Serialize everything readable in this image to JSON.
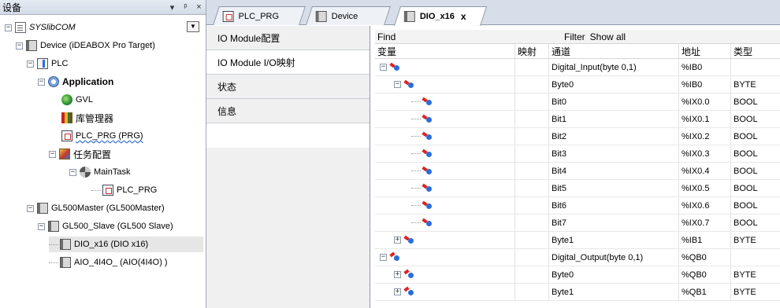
{
  "left_panel": {
    "title": "设备",
    "controls": [
      "▾",
      "ᵖ",
      "×"
    ],
    "tree": [
      {
        "label": "SYSlibCOM",
        "icon": "project-icon",
        "italic": true
      },
      {
        "label": "Device (iDEABOX Pro Target)",
        "icon": "device-icon"
      },
      {
        "label": "PLC",
        "icon": "plc-icon"
      },
      {
        "label": "Application",
        "icon": "application-gear-icon",
        "bold": true
      },
      {
        "label": "GVL",
        "icon": "gvl-icon"
      },
      {
        "label": "库管理器",
        "icon": "library-icon"
      },
      {
        "label": "PLC_PRG (PRG)",
        "icon": "program-icon",
        "wavy": true
      },
      {
        "label": "任务配置",
        "icon": "task-config-icon"
      },
      {
        "label": "MainTask",
        "icon": "maintask-icon"
      },
      {
        "label": "PLC_PRG",
        "icon": "program-call-icon"
      },
      {
        "label": "GL500Master (GL500Master)",
        "icon": "device-icon"
      },
      {
        "label": "GL500_Slave (GL500 Slave)",
        "icon": "device-icon"
      },
      {
        "label": "DIO_x16 (DIO x16)",
        "icon": "device-icon",
        "selected": true
      },
      {
        "label": "AIO_4I4O_ (AIO(4I4O) )",
        "icon": "device-icon"
      }
    ]
  },
  "editor_tabs": [
    {
      "label": "PLC_PRG",
      "icon": "program-icon",
      "active": false
    },
    {
      "label": "Device",
      "icon": "device-icon",
      "active": false
    },
    {
      "label": "DIO_x16",
      "icon": "device-icon",
      "active": true,
      "close": "x"
    }
  ],
  "page_tabs": [
    {
      "label": "IO Module配置",
      "active": false
    },
    {
      "label": "IO Module I/O映射",
      "active": true
    },
    {
      "label": "状态",
      "active": false
    },
    {
      "label": "信息",
      "active": false
    }
  ],
  "grid": {
    "find_label": "Find",
    "filter_label": "Filter",
    "filter_value": "Show all",
    "columns": [
      "变量",
      "映射",
      "通道",
      "地址",
      "类型"
    ],
    "rows": [
      {
        "level": 0,
        "expander": "−",
        "dir": "in",
        "channel": "Digital_Input(byte 0,1)",
        "address": "%IB0",
        "type": ""
      },
      {
        "level": 1,
        "expander": "−",
        "dir": "in",
        "channel": "Byte0",
        "address": "%IB0",
        "type": "BYTE"
      },
      {
        "level": 2,
        "expander": "",
        "dir": "in",
        "channel": "Bit0",
        "address": "%IX0.0",
        "type": "BOOL"
      },
      {
        "level": 2,
        "expander": "",
        "dir": "in",
        "channel": "Bit1",
        "address": "%IX0.1",
        "type": "BOOL"
      },
      {
        "level": 2,
        "expander": "",
        "dir": "in",
        "channel": "Bit2",
        "address": "%IX0.2",
        "type": "BOOL"
      },
      {
        "level": 2,
        "expander": "",
        "dir": "in",
        "channel": "Bit3",
        "address": "%IX0.3",
        "type": "BOOL"
      },
      {
        "level": 2,
        "expander": "",
        "dir": "in",
        "channel": "Bit4",
        "address": "%IX0.4",
        "type": "BOOL"
      },
      {
        "level": 2,
        "expander": "",
        "dir": "in",
        "channel": "Bit5",
        "address": "%IX0.5",
        "type": "BOOL"
      },
      {
        "level": 2,
        "expander": "",
        "dir": "in",
        "channel": "Bit6",
        "address": "%IX0.6",
        "type": "BOOL"
      },
      {
        "level": 2,
        "expander": "",
        "dir": "in",
        "channel": "Bit7",
        "address": "%IX0.7",
        "type": "BOOL"
      },
      {
        "level": 1,
        "expander": "+",
        "dir": "in",
        "channel": "Byte1",
        "address": "%IB1",
        "type": "BYTE"
      },
      {
        "level": 0,
        "expander": "−",
        "dir": "out",
        "channel": "Digital_Output(byte 0,1)",
        "address": "%QB0",
        "type": ""
      },
      {
        "level": 1,
        "expander": "+",
        "dir": "out",
        "channel": "Byte0",
        "address": "%QB0",
        "type": "BYTE"
      },
      {
        "level": 1,
        "expander": "+",
        "dir": "out",
        "channel": "Byte1",
        "address": "%QB1",
        "type": "BYTE"
      }
    ]
  }
}
